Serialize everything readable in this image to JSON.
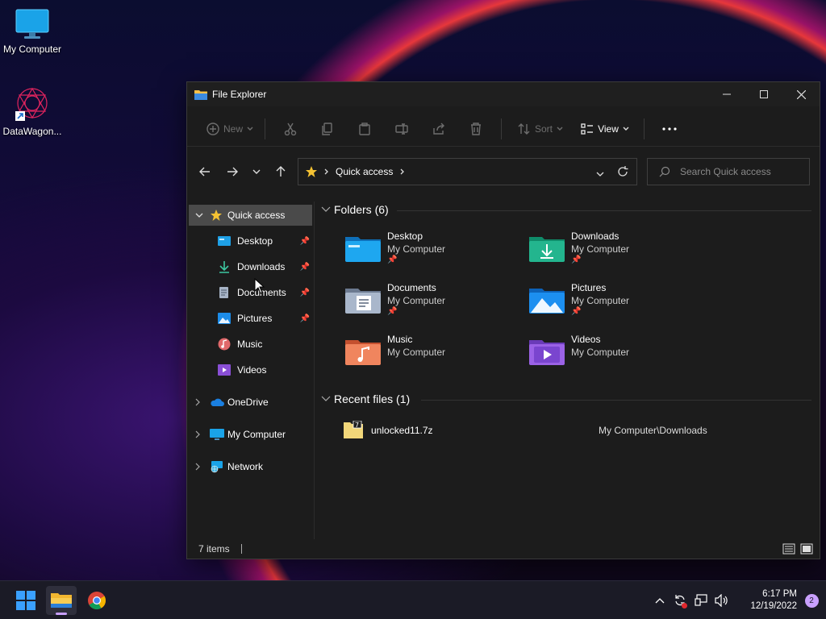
{
  "desktop": {
    "icons": [
      {
        "label": "My Computer"
      },
      {
        "label": "DataWagon..."
      }
    ]
  },
  "window": {
    "title": "File Explorer",
    "toolbar": {
      "new_label": "New",
      "sort_label": "Sort",
      "view_label": "View"
    },
    "address": {
      "path": "Quick access"
    },
    "search": {
      "placeholder": "Search Quick access"
    },
    "nav": {
      "quick_access": "Quick access",
      "items": [
        {
          "label": "Desktop",
          "pinned": true
        },
        {
          "label": "Downloads",
          "pinned": true
        },
        {
          "label": "Documents",
          "pinned": true
        },
        {
          "label": "Pictures",
          "pinned": true
        },
        {
          "label": "Music",
          "pinned": false
        },
        {
          "label": "Videos",
          "pinned": false
        }
      ],
      "roots": [
        {
          "label": "OneDrive"
        },
        {
          "label": "My Computer"
        },
        {
          "label": "Network"
        }
      ]
    },
    "content": {
      "folders_header": "Folders (6)",
      "folders": [
        {
          "name": "Desktop",
          "location": "My Computer",
          "pinned": true
        },
        {
          "name": "Downloads",
          "location": "My Computer",
          "pinned": true
        },
        {
          "name": "Documents",
          "location": "My Computer",
          "pinned": true
        },
        {
          "name": "Pictures",
          "location": "My Computer",
          "pinned": true
        },
        {
          "name": "Music",
          "location": "My Computer",
          "pinned": false
        },
        {
          "name": "Videos",
          "location": "My Computer",
          "pinned": false
        }
      ],
      "recent_header": "Recent files (1)",
      "recent": [
        {
          "name": "unlocked11.7z",
          "path": "My Computer\\Downloads"
        }
      ]
    },
    "status": {
      "items": "7 items"
    }
  },
  "taskbar": {
    "time": "6:17 PM",
    "date": "12/19/2022",
    "notifications": "2"
  },
  "colors": {
    "accent": "#0078d4",
    "window_bg": "#1c1c1c",
    "selected": "#4a4a4a"
  }
}
